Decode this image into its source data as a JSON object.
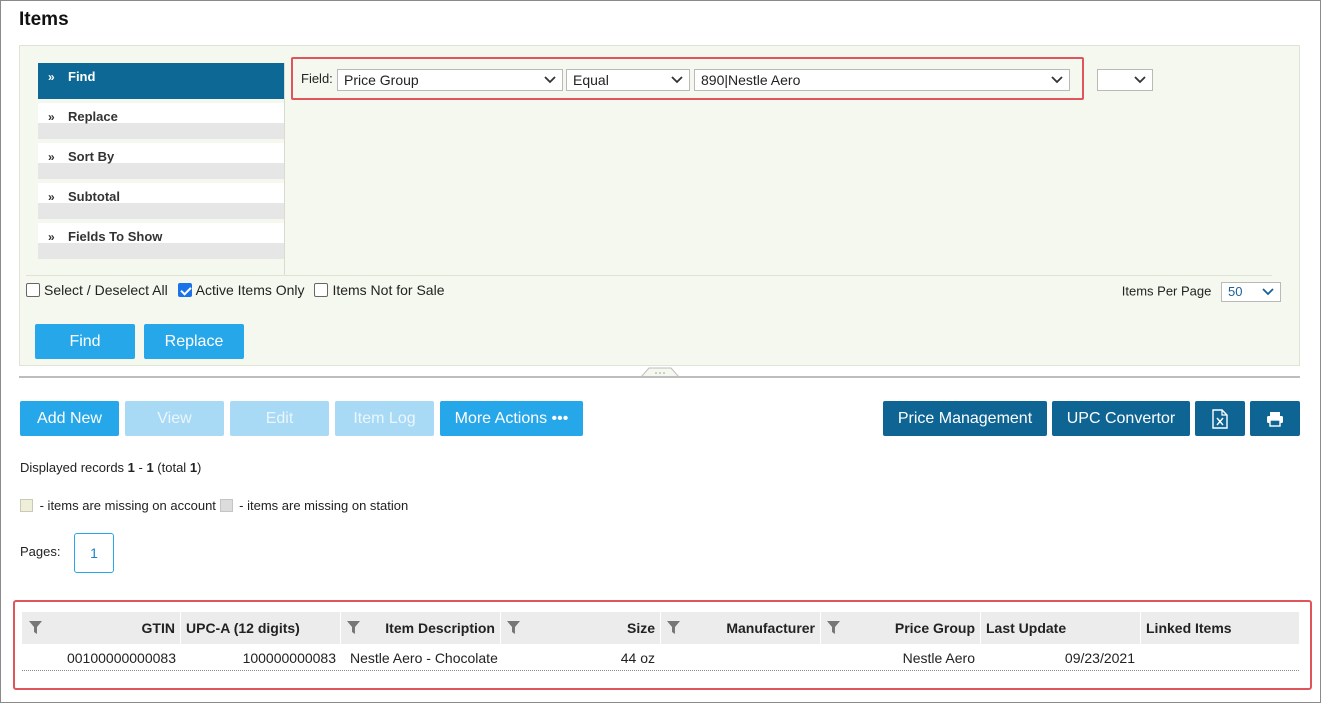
{
  "page": {
    "title": "Items"
  },
  "side_menu": [
    {
      "label": "Find",
      "active": true
    },
    {
      "label": "Replace",
      "active": false
    },
    {
      "label": "Sort By",
      "active": false
    },
    {
      "label": "Subtotal",
      "active": false
    },
    {
      "label": "Fields To Show",
      "active": false
    }
  ],
  "filter": {
    "field_label": "Field:",
    "field_value": "Price Group",
    "operator_value": "Equal",
    "value_value": "890|Nestle Aero",
    "extra_value": ""
  },
  "checkboxes": [
    {
      "label": "Select / Deselect All",
      "checked": false
    },
    {
      "label": "Active Items Only",
      "checked": true
    },
    {
      "label": "Items Not for Sale",
      "checked": false
    }
  ],
  "per_page": {
    "label": "Items Per Page",
    "value": "50"
  },
  "filter_buttons": {
    "find": "Find",
    "replace": "Replace"
  },
  "toolbar": {
    "add_new": "Add New",
    "view": "View",
    "edit": "Edit",
    "item_log": "Item Log",
    "more_actions": "More Actions •••",
    "price_management": "Price Management",
    "upc_convertor": "UPC Convertor"
  },
  "records": {
    "prefix": "Displayed records ",
    "from": "1",
    "dash": " - ",
    "to": "1",
    "total_prefix": " (total ",
    "total": "1",
    "suffix": ")"
  },
  "legend": {
    "account_text": " - items are missing on account",
    "station_text": " - items are missing on station",
    "account_color": "#efefd9",
    "station_color": "#dcdcdc"
  },
  "pagination": {
    "label": "Pages:",
    "current": "1"
  },
  "table": {
    "columns": [
      "GTIN",
      "UPC-A (12 digits)",
      "Item Description",
      "Size",
      "Manufacturer",
      "Price Group",
      "Last Update",
      "Linked Items"
    ],
    "rows": [
      {
        "gtin": "00100000000083",
        "upc_a": "100000000083",
        "description": "Nestle Aero - Chocolate",
        "size": "44 oz",
        "manufacturer": "",
        "price_group": "Nestle Aero",
        "last_update": "09/23/2021",
        "linked_items": ""
      }
    ]
  },
  "colors": {
    "accent": "#26a7ea",
    "dark_accent": "#0e6594",
    "highlight": "#e0555a",
    "panel_bg": "#f5f8ef"
  }
}
